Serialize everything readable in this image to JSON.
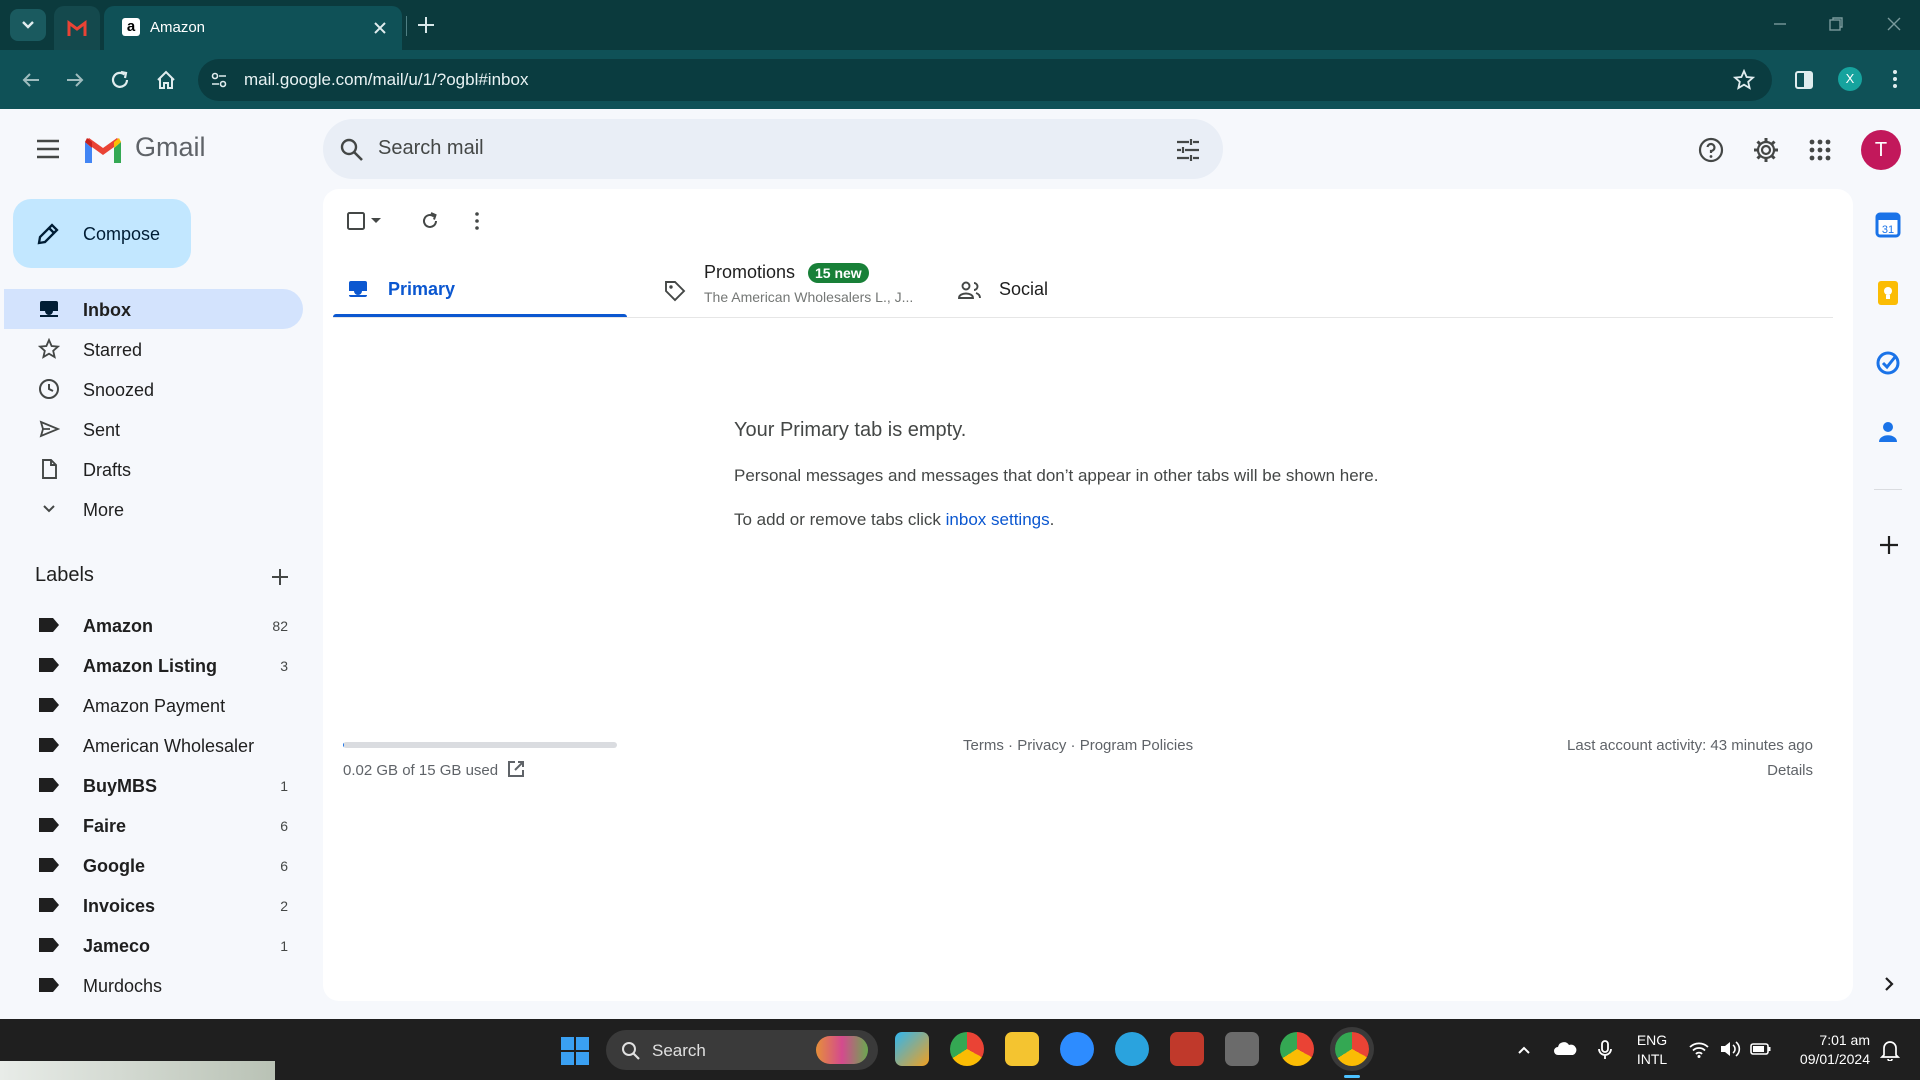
{
  "browser": {
    "tab_title": "Amazon",
    "url": "mail.google.com/mail/u/1/?ogbl#inbox",
    "profile_initial": "X"
  },
  "gmail": {
    "brand": "Gmail",
    "search_placeholder": "Search mail",
    "avatar_initial": "T",
    "compose_label": "Compose",
    "nav": [
      {
        "label": "Inbox",
        "icon": "inbox-icon",
        "active": true
      },
      {
        "label": "Starred",
        "icon": "star-icon"
      },
      {
        "label": "Snoozed",
        "icon": "clock-icon"
      },
      {
        "label": "Sent",
        "icon": "send-icon"
      },
      {
        "label": "Drafts",
        "icon": "draft-icon"
      },
      {
        "label": "More",
        "icon": "chevron-down-icon"
      }
    ],
    "labels_title": "Labels",
    "labels": [
      {
        "name": "Amazon",
        "count": "82",
        "bold": true
      },
      {
        "name": "Amazon Listing",
        "count": "3",
        "bold": true
      },
      {
        "name": "Amazon Payment",
        "count": "",
        "bold": false
      },
      {
        "name": "American Wholesaler",
        "count": "",
        "bold": false
      },
      {
        "name": "BuyMBS",
        "count": "1",
        "bold": true
      },
      {
        "name": "Faire",
        "count": "6",
        "bold": true
      },
      {
        "name": "Google",
        "count": "6",
        "bold": true
      },
      {
        "name": "Invoices",
        "count": "2",
        "bold": true
      },
      {
        "name": "Jameco",
        "count": "1",
        "bold": true
      },
      {
        "name": "Murdochs",
        "count": "",
        "bold": false
      }
    ],
    "tabs": {
      "primary": "Primary",
      "promotions": "Promotions",
      "promotions_badge": "15 new",
      "promotions_sub": "The American Wholesalers L., J...",
      "social": "Social"
    },
    "empty": {
      "title": "Your Primary tab is empty.",
      "line1": "Personal messages and messages that don’t appear in other tabs will be shown here.",
      "line2_prefix": "To add or remove tabs click ",
      "line2_link": "inbox settings",
      "line2_suffix": "."
    },
    "footer": {
      "storage_text": "0.02 GB of 15 GB used",
      "storage_fraction": 0.0013,
      "terms": "Terms",
      "privacy": "Privacy",
      "policies": "Program Policies",
      "activity": "Last account activity: 43 minutes ago",
      "details": "Details"
    }
  },
  "taskbar": {
    "search_label": "Search",
    "lang1": "ENG",
    "lang2": "INTL",
    "time": "7:01 am",
    "date": "09/01/2024"
  },
  "colors": {
    "accent": "#0b57d0",
    "badge_green": "#188038",
    "avatar": "#c2185b"
  }
}
